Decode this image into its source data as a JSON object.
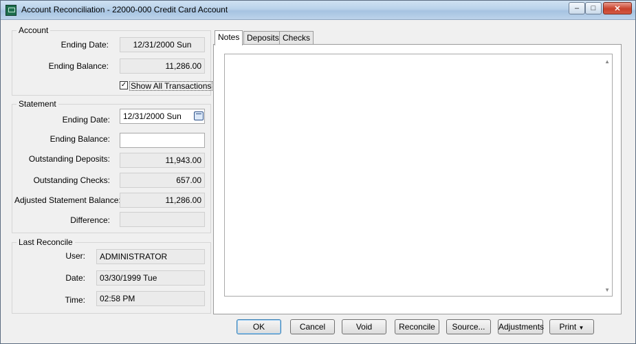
{
  "window": {
    "title": "Account Reconciliation - 22000-000 Credit Card Account"
  },
  "account": {
    "group_label": "Account",
    "ending_date_label": "Ending Date:",
    "ending_date": "12/31/2000 Sun",
    "ending_balance_label": "Ending Balance:",
    "ending_balance": "11,286.00",
    "show_all_label": "Show All Transactions",
    "show_all_checked": true
  },
  "statement": {
    "group_label": "Statement",
    "ending_date_label": "Ending Date:",
    "ending_date": "12/31/2000 Sun",
    "ending_balance_label": "Ending Balance:",
    "ending_balance": "",
    "outstanding_deposits_label": "Outstanding Deposits:",
    "outstanding_deposits": "11,943.00",
    "outstanding_checks_label": "Outstanding Checks:",
    "outstanding_checks": "657.00",
    "adjusted_balance_label": "Adjusted Statement Balance:",
    "adjusted_balance": "11,286.00",
    "difference_label": "Difference:",
    "difference": ""
  },
  "last_reconcile": {
    "group_label": "Last Reconcile",
    "user_label": "User:",
    "user": "ADMINISTRATOR",
    "date_label": "Date:",
    "date": "03/30/1999 Tue",
    "time_label": "Time:",
    "time": "02:58 PM"
  },
  "tabs": [
    {
      "label": "Notes",
      "active": true
    },
    {
      "label": "Deposits",
      "active": false
    },
    {
      "label": "Checks",
      "active": false
    }
  ],
  "notes": {
    "value": ""
  },
  "buttons": {
    "ok": "OK",
    "cancel": "Cancel",
    "void": "Void",
    "reconcile": "Reconcile",
    "source": "Source...",
    "adjustments": "Adjustments",
    "print": "Print"
  },
  "icons": {
    "minimize": "minimize-icon",
    "maximize": "maximize-icon",
    "close": "close-icon",
    "calendar": "calendar-icon",
    "dropdown": "dropdown-arrow-icon"
  }
}
